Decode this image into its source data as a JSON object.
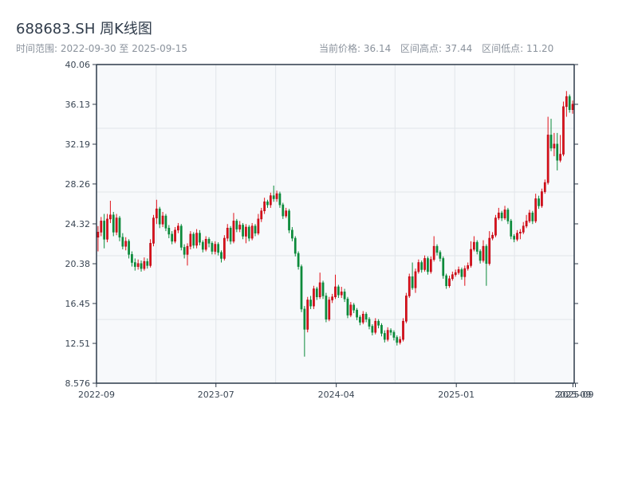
{
  "header": {
    "title": "688683.SH 周K线图",
    "range_label": "时间范围: 2022-09-30 至 2025-09-15",
    "current_price": "当前价格: 36.14",
    "range_high": "区间高点: 37.44",
    "range_low": "区间低点: 11.20"
  },
  "colors": {
    "up": "#e0121a",
    "up_border": "#b00010",
    "down": "#0b8a3a",
    "axis": "#2d3a4a",
    "plot_bg": "#f7f9fb",
    "grid": "#e1e5ea"
  },
  "chart_data": {
    "type": "candlestick",
    "title": "688683.SH 周K线图",
    "ylim": [
      8.576,
      40.06
    ],
    "y_ticks": [
      "8.576",
      "12.51",
      "16.45",
      "20.38",
      "24.32",
      "28.26",
      "32.19",
      "36.13",
      "40.06"
    ],
    "x_ticks": [
      {
        "label": "2022-09",
        "week_index": 0
      },
      {
        "label": "2023-07",
        "week_index": 38.5
      },
      {
        "label": "2024-04",
        "week_index": 77.3
      },
      {
        "label": "2025-01",
        "week_index": 116
      },
      {
        "label": "2025-09",
        "week_index": 153.6
      },
      {
        "label": "2025-09",
        "week_index": 154.4
      }
    ],
    "grid": true,
    "ohlc_fields": [
      "open",
      "high",
      "low",
      "close"
    ],
    "ohlc": [
      [
        23.0,
        24.1,
        21.6,
        23.5
      ],
      [
        23.5,
        25.0,
        23.1,
        24.6
      ],
      [
        24.6,
        25.3,
        21.9,
        22.8
      ],
      [
        22.8,
        25.3,
        22.5,
        24.8
      ],
      [
        24.8,
        26.6,
        24.4,
        25.2
      ],
      [
        25.2,
        25.5,
        23.1,
        23.5
      ],
      [
        23.5,
        25.3,
        23.2,
        24.9
      ],
      [
        24.9,
        25.1,
        22.6,
        23.0
      ],
      [
        23.0,
        23.4,
        21.8,
        22.1
      ],
      [
        22.1,
        23.0,
        21.7,
        22.6
      ],
      [
        22.6,
        22.8,
        20.9,
        21.3
      ],
      [
        21.3,
        21.6,
        20.1,
        20.5
      ],
      [
        20.5,
        20.9,
        19.7,
        20.1
      ],
      [
        20.1,
        20.8,
        19.8,
        20.4
      ],
      [
        20.4,
        20.7,
        19.6,
        19.9
      ],
      [
        19.9,
        21.0,
        19.7,
        20.6
      ],
      [
        20.6,
        20.9,
        19.9,
        20.2
      ],
      [
        20.2,
        22.8,
        20.0,
        22.4
      ],
      [
        22.4,
        25.2,
        22.1,
        24.9
      ],
      [
        24.9,
        26.7,
        24.3,
        25.8
      ],
      [
        25.8,
        26.0,
        23.9,
        24.3
      ],
      [
        24.3,
        25.5,
        24.0,
        25.1
      ],
      [
        25.1,
        25.3,
        23.6,
        23.9
      ],
      [
        23.9,
        24.2,
        22.9,
        23.3
      ],
      [
        23.3,
        23.6,
        22.3,
        22.6
      ],
      [
        22.6,
        24.0,
        22.4,
        23.7
      ],
      [
        23.7,
        24.4,
        23.4,
        24.1
      ],
      [
        24.1,
        24.3,
        21.7,
        22.0
      ],
      [
        22.0,
        22.3,
        20.9,
        21.3
      ],
      [
        21.3,
        22.4,
        20.2,
        22.1
      ],
      [
        22.1,
        23.6,
        21.8,
        23.3
      ],
      [
        23.3,
        23.5,
        21.9,
        22.2
      ],
      [
        22.2,
        23.8,
        21.9,
        23.4
      ],
      [
        23.4,
        23.7,
        22.2,
        22.5
      ],
      [
        22.5,
        22.7,
        21.5,
        21.8
      ],
      [
        21.8,
        23.1,
        21.6,
        22.8
      ],
      [
        22.8,
        23.0,
        22.0,
        22.4
      ],
      [
        22.4,
        22.6,
        21.3,
        21.6
      ],
      [
        21.6,
        22.6,
        21.3,
        22.3
      ],
      [
        22.3,
        22.5,
        21.2,
        21.5
      ],
      [
        21.5,
        21.7,
        20.5,
        20.9
      ],
      [
        20.9,
        23.2,
        20.7,
        22.9
      ],
      [
        22.9,
        24.3,
        22.6,
        23.9
      ],
      [
        23.9,
        24.1,
        22.3,
        22.6
      ],
      [
        22.6,
        25.4,
        22.4,
        24.6
      ],
      [
        24.6,
        24.8,
        23.5,
        23.8
      ],
      [
        23.8,
        24.6,
        23.5,
        24.2
      ],
      [
        24.2,
        24.4,
        22.8,
        23.1
      ],
      [
        23.1,
        24.3,
        22.4,
        24.0
      ],
      [
        24.0,
        24.2,
        22.6,
        22.9
      ],
      [
        22.9,
        24.4,
        22.7,
        24.1
      ],
      [
        24.1,
        24.3,
        23.1,
        23.4
      ],
      [
        23.4,
        25.3,
        23.2,
        24.8
      ],
      [
        24.8,
        25.9,
        24.5,
        25.6
      ],
      [
        25.6,
        26.9,
        25.3,
        26.5
      ],
      [
        26.5,
        26.7,
        25.9,
        26.2
      ],
      [
        26.2,
        27.4,
        25.9,
        27.1
      ],
      [
        27.1,
        28.1,
        26.5,
        26.8
      ],
      [
        26.8,
        27.6,
        26.5,
        27.3
      ],
      [
        27.3,
        27.5,
        25.9,
        26.2
      ],
      [
        26.2,
        26.4,
        24.8,
        25.1
      ],
      [
        25.1,
        25.9,
        24.9,
        25.6
      ],
      [
        25.6,
        25.8,
        23.4,
        23.7
      ],
      [
        23.7,
        24.0,
        22.6,
        22.9
      ],
      [
        22.9,
        23.1,
        21.1,
        21.4
      ],
      [
        21.4,
        21.6,
        19.8,
        20.1
      ],
      [
        20.1,
        20.3,
        15.6,
        15.9
      ],
      [
        15.9,
        16.2,
        11.2,
        13.9
      ],
      [
        13.9,
        17.1,
        13.6,
        16.8
      ],
      [
        16.8,
        17.2,
        15.9,
        16.2
      ],
      [
        16.2,
        18.2,
        15.9,
        17.9
      ],
      [
        17.9,
        18.1,
        16.8,
        17.1
      ],
      [
        17.1,
        19.5,
        16.9,
        18.5
      ],
      [
        18.5,
        18.7,
        16.9,
        17.2
      ],
      [
        17.2,
        17.5,
        14.6,
        14.9
      ],
      [
        14.9,
        17.1,
        14.7,
        16.8
      ],
      [
        16.8,
        17.4,
        16.5,
        17.1
      ],
      [
        17.1,
        19.3,
        16.9,
        18.1
      ],
      [
        18.1,
        18.3,
        17.0,
        17.3
      ],
      [
        17.3,
        18.1,
        17.0,
        17.6
      ],
      [
        17.6,
        17.9,
        16.6,
        16.9
      ],
      [
        16.9,
        17.1,
        15.0,
        15.3
      ],
      [
        15.3,
        16.6,
        15.1,
        16.3
      ],
      [
        16.3,
        16.5,
        15.5,
        15.8
      ],
      [
        15.8,
        16.0,
        14.8,
        15.1
      ],
      [
        15.1,
        15.3,
        14.3,
        14.6
      ],
      [
        14.6,
        15.7,
        14.4,
        15.4
      ],
      [
        15.4,
        15.6,
        14.6,
        14.9
      ],
      [
        14.9,
        15.1,
        13.9,
        14.2
      ],
      [
        14.2,
        14.4,
        13.3,
        13.6
      ],
      [
        13.6,
        15.0,
        13.4,
        14.7
      ],
      [
        14.7,
        14.9,
        14.0,
        14.3
      ],
      [
        14.3,
        14.5,
        13.2,
        13.5
      ],
      [
        13.5,
        13.8,
        12.6,
        12.9
      ],
      [
        12.9,
        14.1,
        12.7,
        13.8
      ],
      [
        13.8,
        14.0,
        13.3,
        13.6
      ],
      [
        13.6,
        13.8,
        12.8,
        13.1
      ],
      [
        13.1,
        13.3,
        12.3,
        12.6
      ],
      [
        12.6,
        13.2,
        12.4,
        12.9
      ],
      [
        12.9,
        15.0,
        12.7,
        14.7
      ],
      [
        14.7,
        17.5,
        14.5,
        17.2
      ],
      [
        17.2,
        19.4,
        17.0,
        19.1
      ],
      [
        19.1,
        20.5,
        17.8,
        18.0
      ],
      [
        18.0,
        19.9,
        17.5,
        19.6
      ],
      [
        19.6,
        20.8,
        19.4,
        20.5
      ],
      [
        20.5,
        20.7,
        19.5,
        19.8
      ],
      [
        19.8,
        21.2,
        19.6,
        20.9
      ],
      [
        20.9,
        21.1,
        19.3,
        19.6
      ],
      [
        19.6,
        21.1,
        19.4,
        20.8
      ],
      [
        20.8,
        23.1,
        20.6,
        22.1
      ],
      [
        22.1,
        22.3,
        21.2,
        21.5
      ],
      [
        21.5,
        21.7,
        20.6,
        20.9
      ],
      [
        20.9,
        21.1,
        18.9,
        19.2
      ],
      [
        19.2,
        19.4,
        17.9,
        18.2
      ],
      [
        18.2,
        19.2,
        18.0,
        18.9
      ],
      [
        18.9,
        19.6,
        18.7,
        19.3
      ],
      [
        19.3,
        19.8,
        19.1,
        19.5
      ],
      [
        19.5,
        20.1,
        19.3,
        19.8
      ],
      [
        19.8,
        20.0,
        18.8,
        19.1
      ],
      [
        19.1,
        20.2,
        18.2,
        19.9
      ],
      [
        19.9,
        20.5,
        19.7,
        20.2
      ],
      [
        20.2,
        22.6,
        20.0,
        21.8
      ],
      [
        21.8,
        23.1,
        21.6,
        22.5
      ],
      [
        22.5,
        22.7,
        21.3,
        21.6
      ],
      [
        21.6,
        21.8,
        20.4,
        20.7
      ],
      [
        20.7,
        22.7,
        20.5,
        22.1
      ],
      [
        22.1,
        22.3,
        18.2,
        20.4
      ],
      [
        20.4,
        23.6,
        20.2,
        22.9
      ],
      [
        22.9,
        23.5,
        22.7,
        23.2
      ],
      [
        23.2,
        25.2,
        23.0,
        24.9
      ],
      [
        24.9,
        25.9,
        24.7,
        25.4
      ],
      [
        25.4,
        25.6,
        24.6,
        24.9
      ],
      [
        24.9,
        26.1,
        24.7,
        25.7
      ],
      [
        25.7,
        25.9,
        24.3,
        24.6
      ],
      [
        24.6,
        24.8,
        22.8,
        23.1
      ],
      [
        23.1,
        23.3,
        22.5,
        22.8
      ],
      [
        22.8,
        23.7,
        22.6,
        23.4
      ],
      [
        23.4,
        23.8,
        22.8,
        23.5
      ],
      [
        23.5,
        24.5,
        23.3,
        24.1
      ],
      [
        24.1,
        25.2,
        23.9,
        24.6
      ],
      [
        24.6,
        25.7,
        24.4,
        25.4
      ],
      [
        25.4,
        25.6,
        24.3,
        24.6
      ],
      [
        24.6,
        27.3,
        24.4,
        26.8
      ],
      [
        26.8,
        27.1,
        25.8,
        26.1
      ],
      [
        26.1,
        27.8,
        25.9,
        27.5
      ],
      [
        27.5,
        28.7,
        27.3,
        28.4
      ],
      [
        28.4,
        34.9,
        28.2,
        33.1
      ],
      [
        33.1,
        34.7,
        31.5,
        31.8
      ],
      [
        31.8,
        33.3,
        31.0,
        32.2
      ],
      [
        32.2,
        33.3,
        29.6,
        30.6
      ],
      [
        30.6,
        33.1,
        30.4,
        31.2
      ],
      [
        31.2,
        36.4,
        31.0,
        35.9
      ],
      [
        35.9,
        37.44,
        34.9,
        36.9
      ],
      [
        36.9,
        37.1,
        35.3,
        35.6
      ],
      [
        35.6,
        36.5,
        35.2,
        36.14
      ]
    ]
  }
}
